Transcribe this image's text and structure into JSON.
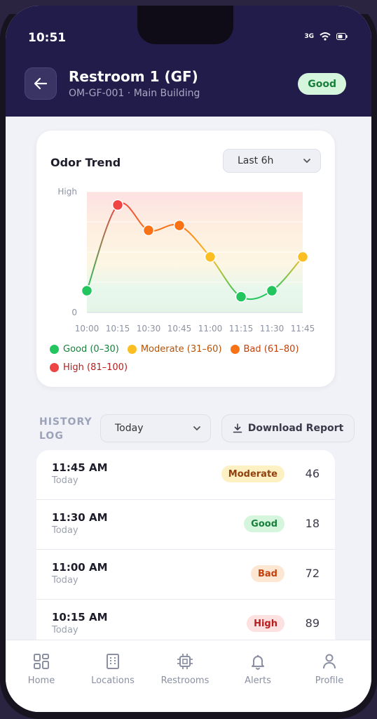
{
  "status_bar": {
    "time": "10:51",
    "network": "3G"
  },
  "header": {
    "title": "Restroom 1 (GF)",
    "subtitle": "OM-GF-001 · Main Building",
    "status": "Good"
  },
  "trend_card": {
    "title": "Odor Trend",
    "range_selected": "Last 6h"
  },
  "chart_data": {
    "type": "line",
    "title": "Odor Trend",
    "x": [
      "10:00",
      "10:15",
      "10:30",
      "10:45",
      "11:00",
      "11:15",
      "11:30",
      "11:45"
    ],
    "values": [
      18,
      89,
      68,
      72,
      46,
      13,
      18,
      46
    ],
    "y_tick_labels": [
      "High",
      "0"
    ],
    "ylim": [
      0,
      100
    ],
    "bands": [
      {
        "name": "Good (0–30)",
        "from": 0,
        "to": 30,
        "color": "#22c55e"
      },
      {
        "name": "Moderate (31–60)",
        "from": 31,
        "to": 60,
        "color": "#fbbf24"
      },
      {
        "name": "Bad (61–80)",
        "from": 61,
        "to": 80,
        "color": "#f97316"
      },
      {
        "name": "High (81–100)",
        "from": 81,
        "to": 100,
        "color": "#ef4444"
      }
    ],
    "grid": true,
    "legend_placement": "bottom"
  },
  "legend": [
    {
      "label": "Good (0–30)",
      "color": "#22c55e",
      "text_color": "#17803a"
    },
    {
      "label": "Moderate (31–60)",
      "color": "#fbbf24",
      "text_color": "#b45309"
    },
    {
      "label": "Bad (61–80)",
      "color": "#f97316",
      "text_color": "#c2410c"
    },
    {
      "label": "High (81–100)",
      "color": "#ef4444",
      "text_color": "#b91c1c"
    }
  ],
  "history": {
    "label": "HISTORY LOG",
    "day_selected": "Today",
    "download_label": "Download Report",
    "rows": [
      {
        "time": "11:45 AM",
        "day": "Today",
        "status": "Moderate",
        "value": "46"
      },
      {
        "time": "11:30 AM",
        "day": "Today",
        "status": "Good",
        "value": "18"
      },
      {
        "time": "11:00 AM",
        "day": "Today",
        "status": "Bad",
        "value": "72"
      },
      {
        "time": "10:15 AM",
        "day": "Today",
        "status": "High",
        "value": "89"
      }
    ]
  },
  "tabs": [
    {
      "label": "Home",
      "icon": "grid-icon"
    },
    {
      "label": "Locations",
      "icon": "building-icon"
    },
    {
      "label": "Restrooms",
      "icon": "chip-icon"
    },
    {
      "label": "Alerts",
      "icon": "bell-icon"
    },
    {
      "label": "Profile",
      "icon": "user-icon"
    }
  ],
  "colors": {
    "header_bg": "#221c4a",
    "good_bg": "#d6f5dd",
    "good_fg": "#17803a",
    "moderate_bg": "#fdf1c4",
    "moderate_fg": "#92400e",
    "bad_bg": "#fde6d2",
    "bad_fg": "#c2410c",
    "high_bg": "#fde0e0",
    "high_fg": "#b91c1c"
  }
}
